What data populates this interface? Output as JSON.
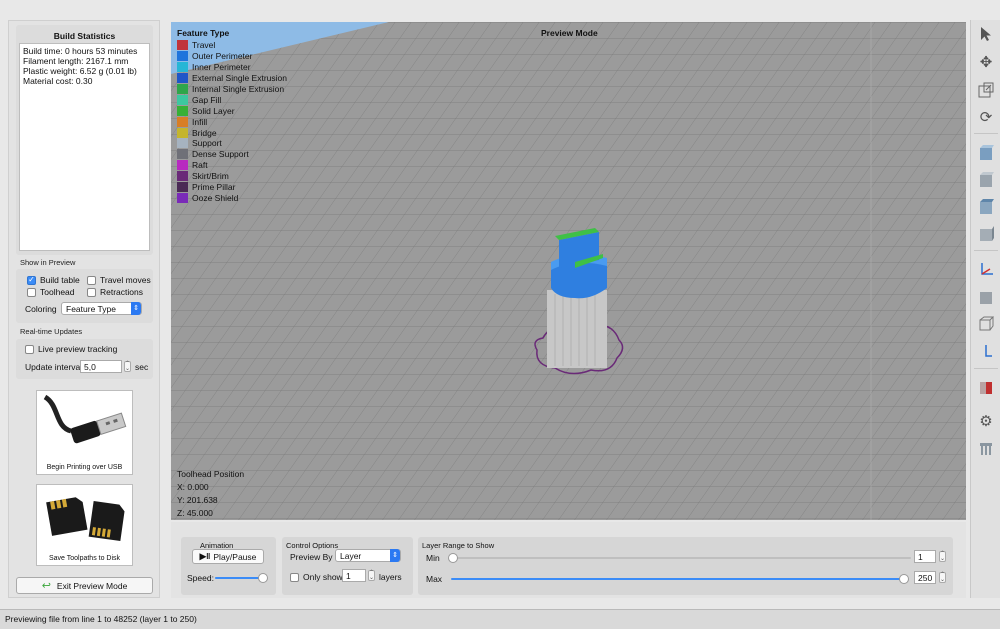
{
  "build_stats": {
    "title": "Build Statistics",
    "lines": [
      "Build time: 0 hours 53 minutes",
      "Filament length: 2167.1 mm",
      "Plastic weight: 6.52 g (0.01 lb)",
      "Material cost: 0.30"
    ]
  },
  "show_in_preview": {
    "title": "Show in Preview",
    "build_table": {
      "label": "Build table",
      "checked": true
    },
    "travel_moves": {
      "label": "Travel moves",
      "checked": false
    },
    "toolhead": {
      "label": "Toolhead",
      "checked": false
    },
    "retractions": {
      "label": "Retractions",
      "checked": false
    },
    "coloring_label": "Coloring",
    "coloring_value": "Feature Type"
  },
  "realtime": {
    "title": "Real-time Updates",
    "live_tracking": {
      "label": "Live preview tracking",
      "checked": false
    },
    "interval_label": "Update interval",
    "interval_value": "5,0",
    "interval_unit": "sec"
  },
  "usb_card": {
    "caption": "Begin Printing over USB"
  },
  "disk_card": {
    "caption": "Save Toolpaths to Disk"
  },
  "exit_button": {
    "label": "Exit Preview Mode"
  },
  "viewport": {
    "mode": "Preview Mode",
    "legend_title": "Feature Type",
    "legend": [
      {
        "label": "Travel",
        "color": "#c0343c"
      },
      {
        "label": "Outer Perimeter",
        "color": "#1f74dc"
      },
      {
        "label": "Inner Perimeter",
        "color": "#27b6d6"
      },
      {
        "label": "External Single Extrusion",
        "color": "#1f56c8"
      },
      {
        "label": "Internal Single Extrusion",
        "color": "#2fa64a"
      },
      {
        "label": "Gap Fill",
        "color": "#3cc8a0"
      },
      {
        "label": "Solid Layer",
        "color": "#36b036"
      },
      {
        "label": "Infill",
        "color": "#d87e26"
      },
      {
        "label": "Bridge",
        "color": "#c4b52e"
      },
      {
        "label": "Support",
        "color": "#a6b3c0"
      },
      {
        "label": "Dense Support",
        "color": "#6f7078"
      },
      {
        "label": "Raft",
        "color": "#b82ac0"
      },
      {
        "label": "Skirt/Brim",
        "color": "#6a2a78"
      },
      {
        "label": "Prime Pillar",
        "color": "#4a2a55"
      },
      {
        "label": "Ooze Shield",
        "color": "#7a2ab8"
      }
    ],
    "toolhead": {
      "title": "Toolhead Position",
      "x": "X: 0.000",
      "y": "Y: 201.638",
      "z": "Z: 45.000"
    }
  },
  "animation": {
    "title": "Animation",
    "play_label": "Play/Pause",
    "speed_label": "Speed:",
    "speed_fraction": 0.95
  },
  "control_options": {
    "title": "Control Options",
    "preview_by_label": "Preview By",
    "preview_by_value": "Layer",
    "only_show_label": "Only show",
    "only_show_value": "1",
    "only_show_unit": "layers"
  },
  "layer_range": {
    "title": "Layer Range to Show",
    "min_label": "Min",
    "min_value": "1",
    "max_label": "Max",
    "max_value": "250"
  },
  "right_toolbar": [
    "select-arrow-icon",
    "move-icon",
    "scale-icon",
    "rotate-icon",
    "view-cube-front-icon",
    "view-cube-back-icon",
    "view-cube-left-icon",
    "view-cube-right-icon",
    "axes-icon",
    "solid-view-icon",
    "wireframe-view-icon",
    "axis-z-icon",
    "section-view-icon",
    "settings-gear-icon",
    "support-icon"
  ],
  "status_bar": {
    "text": "Previewing file from line 1 to 48252 (layer 1 to 250)"
  }
}
